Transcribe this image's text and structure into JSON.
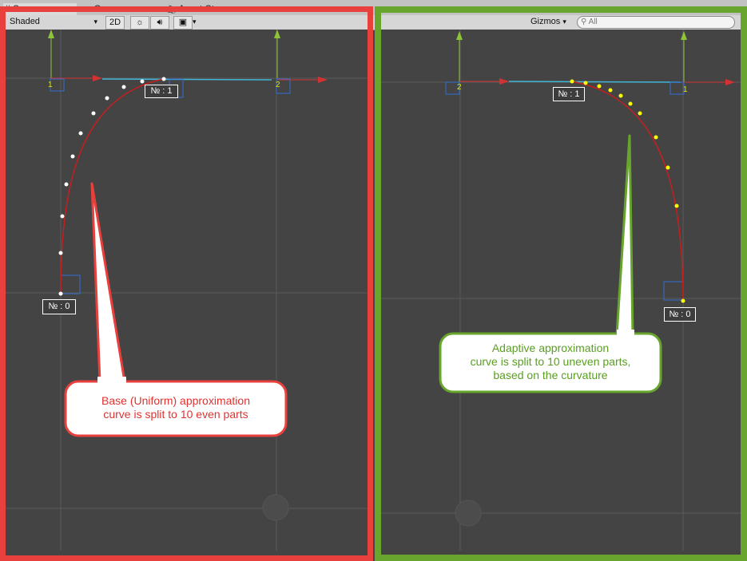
{
  "left_panel": {
    "tabs": [
      {
        "icon": "hash-icon",
        "label": "Scene"
      },
      {
        "icon": "pacman-icon",
        "label": "Game"
      },
      {
        "icon": "store-bag-icon",
        "label": "Asset Store"
      }
    ],
    "toolbar": {
      "shading_mode": "Shaded",
      "view_2d_label": "2D",
      "icons": [
        "sun-icon",
        "speaker-icon",
        "image-icon"
      ]
    },
    "axis_labels": {
      "x_start": "1",
      "x_end": "2"
    },
    "node_labels": {
      "node_1": "№ : 1",
      "node_0": "№ : 0"
    },
    "callout": {
      "line1": "Base (Uniform) approximation",
      "line2": "curve is split to 10 even parts"
    },
    "sample_point_color": "#ffffff"
  },
  "right_panel": {
    "toolbar": {
      "gizmos_label": "Gizmos",
      "search_placeholder": "All"
    },
    "axis_labels": {
      "x_start": "2",
      "x_end": "1"
    },
    "node_labels": {
      "node_1": "№ : 1",
      "node_0": "№ : 0"
    },
    "callout": {
      "line1": "Adaptive approximation",
      "line2": "curve is split to 10 uneven parts,",
      "line3": "based on the curvature"
    },
    "sample_point_color": "#ffff00"
  },
  "colors": {
    "left_frame": "#e8403d",
    "right_frame": "#67a52c",
    "curve": "#c81e1e",
    "x_axis": "#d23232",
    "y_axis": "#8fc43a",
    "tangent_line": "#3fb6d6",
    "handle_box": "#2f6fd6",
    "scene_bg": "#444444"
  }
}
